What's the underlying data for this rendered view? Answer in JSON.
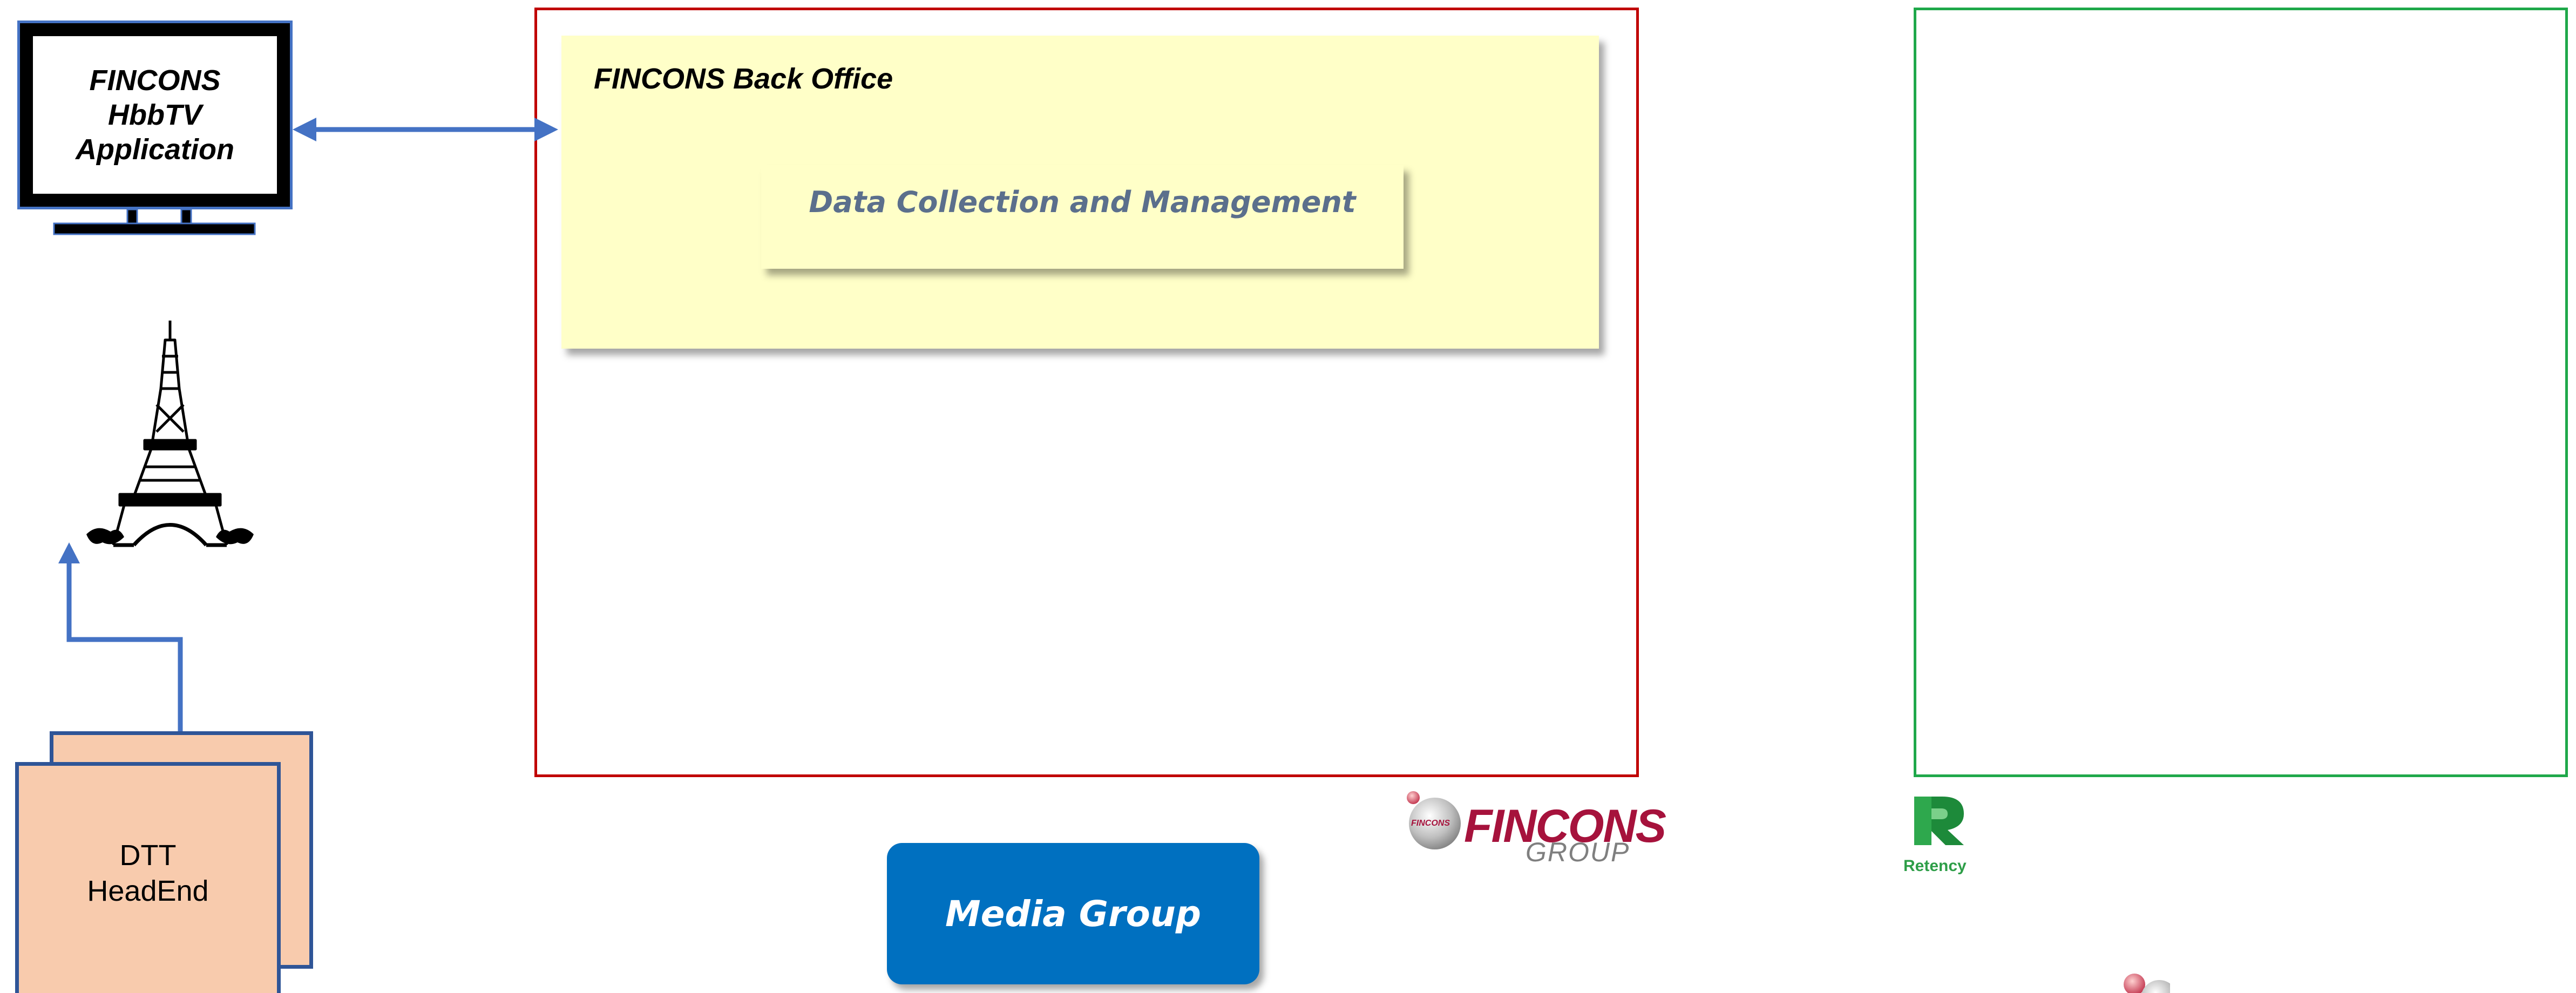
{
  "tv_application": {
    "label": "FINCONS\nHbbTV\nApplication",
    "icon": "tv-monitor-icon"
  },
  "back_office": {
    "title": "FINCONS Back Office",
    "module": "Data Collection and Management"
  },
  "broadcast": {
    "icon": "eiffel-tower-icon",
    "headend_label": "DTT\nHeadEnd"
  },
  "media_group": {
    "label": "Media Group"
  },
  "logos": {
    "fincons_name": "FINCONS",
    "fincons_group": "GROUP",
    "fincons_ball_label": "FINCONS",
    "retency_label": "Retency"
  },
  "colors": {
    "arrow_blue": "#4472c4",
    "backoffice_border": "#c00000",
    "backoffice_fill": "#ffffc8",
    "partner_border": "#1fa84a",
    "headend_fill": "#f8cbad",
    "media_group_fill": "#0070c0",
    "fincons_brand": "#a6123c",
    "retency_brand": "#2e9e48"
  }
}
